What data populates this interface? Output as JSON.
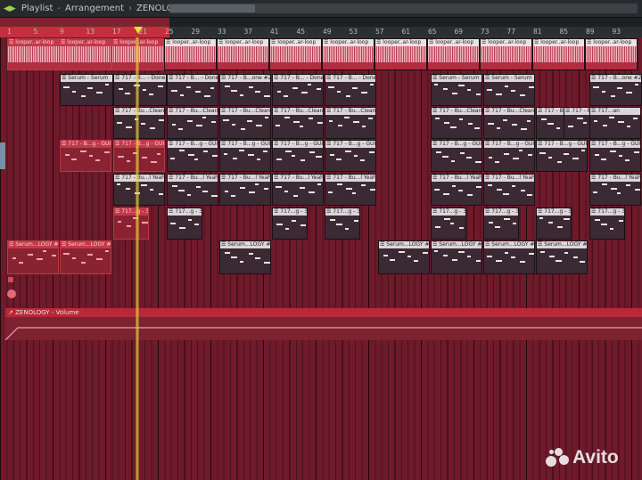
{
  "titlebar": {
    "crumb1": "Playlist",
    "crumb2": "Arrangement",
    "crumb3": "ZENOLOGY - Volume",
    "sep": "-",
    "sep2": "›",
    "sep3": "›",
    "arrows_icon": "nav-arrows-icon"
  },
  "ruler": {
    "bars": [
      "1",
      "5",
      "9",
      "13",
      "17",
      "21",
      "25",
      "29",
      "33",
      "37",
      "41",
      "45",
      "49",
      "53",
      "57",
      "61",
      "65",
      "69",
      "73",
      "77",
      "81",
      "85",
      "89",
      "93"
    ]
  },
  "tracks": {
    "audio": {
      "clips": [
        "looper..ar-loop",
        "looper..ar-loop",
        "looper..ar-loop",
        "looper..ar-loop",
        "looper..ar-loop",
        "looper..ar-loop",
        "looper..ar-loop",
        "looper..ar-loop",
        "looper..ar-loop",
        "looper..ar-loop",
        "looper..ar-loop",
        "looper..ar-loop"
      ]
    },
    "row1": [
      "Serum - Serum",
      "717 - B... - Done",
      "717 - B... - Done",
      "717 - B...one #2",
      "717 - B... - Done",
      "717 - B... - Done",
      "Serum - Serum",
      "Serum - Serum",
      "717 - B...one #2"
    ],
    "row2": [
      "717 - Bu...Clean",
      "717 - Bu...Clean",
      "717 - Bu...Clean",
      "717 - Bu...Clean",
      "717 - Bu...Clean",
      "717 - Bu...Clean",
      "717 - Bu...Clean",
      "717 - Bu...Clean",
      "717 - Bu...Clean",
      "717...an",
      "717 - Bu...Clean"
    ],
    "row3": [
      "717 - B...g - GUI",
      "717 - B...g - GUI",
      "717 - B...g - GUI",
      "717 - B...g - GUI",
      "717 - B...g - GUI",
      "717 - B...g - GUI",
      "717 - B...g - GUI",
      "717 - B...g - GUI",
      "717 - B...g - GUI",
      "717 - B...g - GUI",
      "717 - B...g - GUI",
      "717 - B...g - GUI"
    ],
    "row4": [
      "717 - Bu...l Yeah",
      "717 - Bu...l Yeah",
      "717 - Bu...l Yeah",
      "717 - Bu...l Yeah",
      "717 - Bu...l Yeah",
      "717 - Bu...l Yeah",
      "717 - Bu...l Yeah",
      "717 - Bu...l Yeah"
    ],
    "row5": [
      "717...g - 3",
      "717...g - 3",
      "717...g - 3",
      "717...g - 3",
      "717...g - 3",
      "717...g - 3",
      "717...g - 3",
      "717...g - 3"
    ],
    "row6": [
      "Serum...LOGY #2",
      "Serum...LOGY #2",
      "Serum...LOGY #2",
      "Serum...LOGY #2",
      "Serum...LOGY #2",
      "Serum...LOGY #2",
      "Serum...LOGY #2"
    ]
  },
  "automation": {
    "label": "ZENOLOGY - Volume"
  },
  "watermark": {
    "text": "Avito"
  },
  "colors": {
    "background": "#6e1a2b",
    "clip": "#3b2a33",
    "automation": "#b42a36",
    "playhead": "#e8e03b"
  }
}
